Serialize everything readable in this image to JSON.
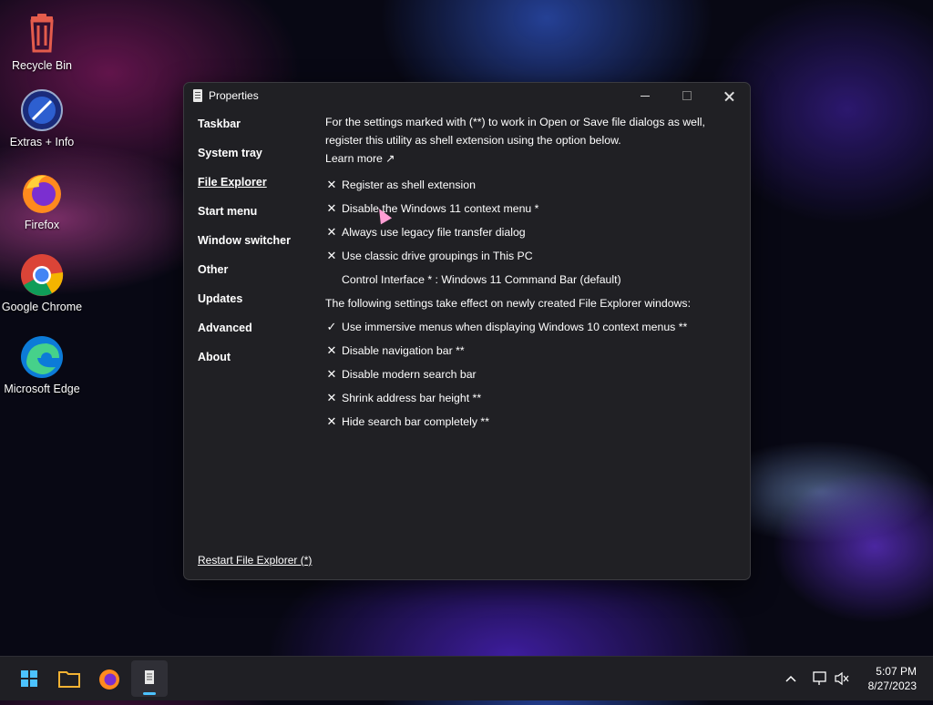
{
  "desktop": {
    "icons": [
      {
        "label": "Recycle Bin"
      },
      {
        "label": "Extras + Info"
      },
      {
        "label": "Firefox"
      },
      {
        "label": "Google Chrome"
      },
      {
        "label": "Microsoft Edge"
      }
    ]
  },
  "window": {
    "title": "Properties",
    "nav": [
      "Taskbar",
      "System tray",
      "File Explorer",
      "Start menu",
      "Window switcher",
      "Other",
      "Updates",
      "Advanced",
      "About"
    ],
    "active_nav": "File Explorer",
    "intro": "For the settings marked with (**) to work in Open or Save file dialogs as well, register this utility as shell extension using the option below.",
    "learn_more": "Learn more ↗",
    "options1": [
      {
        "mark": "✕",
        "label": "Register as shell extension"
      },
      {
        "mark": "✕",
        "label": "Disable the Windows 11 context menu *"
      },
      {
        "mark": "✕",
        "label": "Always use legacy file transfer dialog"
      },
      {
        "mark": "✕",
        "label": "Use classic drive groupings in This PC"
      }
    ],
    "control_interface": "Control Interface * : Windows 11 Command Bar (default)",
    "section2": "The following settings take effect on newly created File Explorer windows:",
    "options2": [
      {
        "mark": "✓",
        "label": "Use immersive menus when displaying Windows 10 context menus **"
      },
      {
        "mark": "✕",
        "label": "Disable navigation bar **"
      },
      {
        "mark": "✕",
        "label": "Disable modern search bar"
      },
      {
        "mark": "✕",
        "label": "Shrink address bar height **"
      },
      {
        "mark": "✕",
        "label": "Hide search bar completely **"
      }
    ],
    "restart": "Restart File Explorer (*)"
  },
  "taskbar": {
    "apps": [
      "start-icon",
      "file-explorer-icon",
      "firefox-icon",
      "properties-app-icon"
    ],
    "time": "5:07 PM",
    "date": "8/27/2023"
  },
  "colors": {
    "accent": "#4cc2ff",
    "window_bg": "#202024",
    "taskbar_bg": "#1f1f24"
  }
}
